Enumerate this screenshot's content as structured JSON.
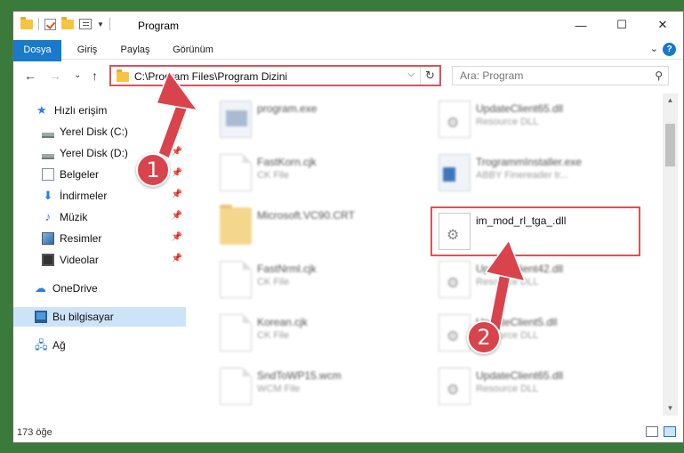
{
  "window": {
    "title": "Program",
    "minimize": "—",
    "maximize": "☐",
    "close": "✕"
  },
  "ribbon": {
    "tabs": [
      "Dosya",
      "Giriş",
      "Paylaş",
      "Görünüm"
    ],
    "expand": "⌄",
    "help": "?"
  },
  "nav": {
    "back": "←",
    "forward": "→",
    "recent": "⌄",
    "up": "↑",
    "address": "C:\\Program Files\\Program Dizini",
    "address_dropdown": "⌵",
    "refresh": "↻",
    "search_placeholder": "Ara: Program"
  },
  "sidebar": {
    "items": [
      {
        "label": "Hızlı erişim",
        "icon": "star-icon",
        "pinned": false
      },
      {
        "label": "Yerel Disk (C:)",
        "icon": "drive-icon",
        "pinned": true
      },
      {
        "label": "Yerel Disk (D:)",
        "icon": "drive-icon",
        "pinned": true
      },
      {
        "label": "Belgeler",
        "icon": "documents-icon",
        "pinned": true
      },
      {
        "label": "İndirmeler",
        "icon": "download-icon",
        "pinned": true
      },
      {
        "label": "Müzik",
        "icon": "music-icon",
        "pinned": true
      },
      {
        "label": "Resimler",
        "icon": "pictures-icon",
        "pinned": true
      },
      {
        "label": "Videolar",
        "icon": "videos-icon",
        "pinned": true
      },
      {
        "label": "OneDrive",
        "icon": "cloud-icon",
        "pinned": false
      },
      {
        "label": "Bu bilgisayar",
        "icon": "computer-icon",
        "pinned": false,
        "selected": true
      },
      {
        "label": "Ağ",
        "icon": "network-icon",
        "pinned": false
      }
    ],
    "pin_glyph": "📌"
  },
  "files": {
    "left": [
      {
        "name": "program.exe",
        "type": "",
        "icon": "exe-icon"
      },
      {
        "name": "FastKorn.cjk",
        "type": "CK File",
        "icon": "document-icon"
      },
      {
        "name": "Microsoft.VC90.CRT",
        "type": "",
        "icon": "folder-icon"
      },
      {
        "name": "FastNrml.cjk",
        "type": "CK File",
        "icon": "document-icon"
      },
      {
        "name": "Korean.cjk",
        "type": "CK File",
        "icon": "document-icon"
      },
      {
        "name": "SndToWP15.wcm",
        "type": "WCM File",
        "icon": "document-icon"
      }
    ],
    "right": [
      {
        "name": "UpdateClient65.dll",
        "type": "Resource DLL",
        "icon": "dll-icon",
        "blurred": true
      },
      {
        "name": "TrogrammInstaller.exe",
        "type": "ABBY Finereader tr...",
        "icon": "installer-icon",
        "blurred": true
      },
      {
        "name": "im_mod_rl_tga_.dll",
        "type": "",
        "icon": "dll-icon",
        "blurred": false
      },
      {
        "name": "UpdateClient42.dll",
        "type": "Resource DLL",
        "icon": "dll-icon",
        "blurred": true
      },
      {
        "name": "UpdateClient5.dll",
        "type": "Resource DLL",
        "icon": "dll-icon",
        "blurred": true
      },
      {
        "name": "UpdateClient65.dll",
        "type": "Resource DLL",
        "icon": "dll-icon",
        "blurred": true
      }
    ]
  },
  "status": {
    "count": "173 öğe"
  },
  "annotations": {
    "step1": "1",
    "step2": "2"
  },
  "colors": {
    "accent": "#1979ca",
    "annotation": "#d9434c",
    "highlight": "#d9535a"
  }
}
